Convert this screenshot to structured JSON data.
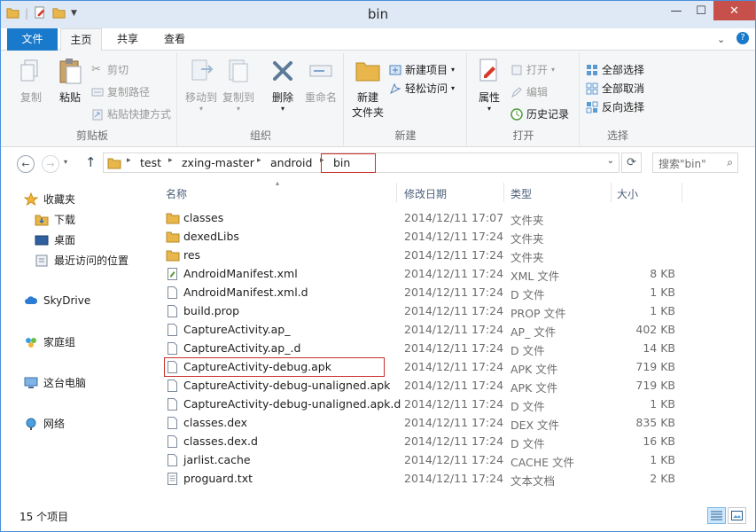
{
  "window": {
    "title": "bin"
  },
  "colors": {
    "accent": "#1979ca",
    "highlight": "#c9302c",
    "folder": "#e8b64a"
  },
  "tabs": [
    {
      "label": "文件"
    },
    {
      "label": "主页"
    },
    {
      "label": "共享"
    },
    {
      "label": "查看"
    }
  ],
  "ribbon": {
    "clipboard": {
      "label": "剪贴板",
      "copy": "复制",
      "paste": "粘贴",
      "cut": "剪切",
      "copy_path": "复制路径",
      "paste_shortcut": "粘贴快捷方式"
    },
    "organize": {
      "label": "组织",
      "move_to": "移动到",
      "copy_to": "复制到",
      "delete": "删除",
      "rename": "重命名"
    },
    "new": {
      "label": "新建",
      "new_folder_l1": "新建",
      "new_folder_l2": "文件夹",
      "new_item": "新建项目",
      "easy_access": "轻松访问"
    },
    "open": {
      "label": "打开",
      "properties": "属性",
      "open": "打开",
      "edit": "编辑",
      "history": "历史记录"
    },
    "select": {
      "label": "选择",
      "select_all": "全部选择",
      "select_none": "全部取消",
      "invert": "反向选择"
    }
  },
  "address": {
    "crumbs": [
      "test",
      "zxing-master",
      "android",
      "bin"
    ],
    "search_placeholder": "搜索\"bin\""
  },
  "nav": {
    "favorites": "收藏夹",
    "downloads": "下载",
    "desktop": "桌面",
    "recent": "最近访问的位置",
    "skydrive": "SkyDrive",
    "homegroup": "家庭组",
    "this_pc": "这台电脑",
    "network": "网络"
  },
  "columns": {
    "name": "名称",
    "date": "修改日期",
    "type": "类型",
    "size": "大小"
  },
  "files": [
    {
      "name": "classes",
      "date": "2014/12/11 17:07",
      "type": "文件夹",
      "size": "",
      "icon": "folder-icon"
    },
    {
      "name": "dexedLibs",
      "date": "2014/12/11 17:24",
      "type": "文件夹",
      "size": "",
      "icon": "folder-icon"
    },
    {
      "name": "res",
      "date": "2014/12/11 17:24",
      "type": "文件夹",
      "size": "",
      "icon": "folder-icon"
    },
    {
      "name": "AndroidManifest.xml",
      "date": "2014/12/11 17:24",
      "type": "XML 文件",
      "size": "8 KB",
      "icon": "xml-file-icon"
    },
    {
      "name": "AndroidManifest.xml.d",
      "date": "2014/12/11 17:24",
      "type": "D 文件",
      "size": "1 KB",
      "icon": "file-icon"
    },
    {
      "name": "build.prop",
      "date": "2014/12/11 17:24",
      "type": "PROP 文件",
      "size": "1 KB",
      "icon": "file-icon"
    },
    {
      "name": "CaptureActivity.ap_",
      "date": "2014/12/11 17:24",
      "type": "AP_ 文件",
      "size": "402 KB",
      "icon": "file-icon"
    },
    {
      "name": "CaptureActivity.ap_.d",
      "date": "2014/12/11 17:24",
      "type": "D 文件",
      "size": "14 KB",
      "icon": "file-icon"
    },
    {
      "name": "CaptureActivity-debug.apk",
      "date": "2014/12/11 17:24",
      "type": "APK 文件",
      "size": "719 KB",
      "icon": "file-icon"
    },
    {
      "name": "CaptureActivity-debug-unaligned.apk",
      "date": "2014/12/11 17:24",
      "type": "APK 文件",
      "size": "719 KB",
      "icon": "file-icon"
    },
    {
      "name": "CaptureActivity-debug-unaligned.apk.d",
      "date": "2014/12/11 17:24",
      "type": "D 文件",
      "size": "1 KB",
      "icon": "file-icon"
    },
    {
      "name": "classes.dex",
      "date": "2014/12/11 17:24",
      "type": "DEX 文件",
      "size": "835 KB",
      "icon": "file-icon"
    },
    {
      "name": "classes.dex.d",
      "date": "2014/12/11 17:24",
      "type": "D 文件",
      "size": "16 KB",
      "icon": "file-icon"
    },
    {
      "name": "jarlist.cache",
      "date": "2014/12/11 17:24",
      "type": "CACHE 文件",
      "size": "1 KB",
      "icon": "file-icon"
    },
    {
      "name": "proguard.txt",
      "date": "2014/12/11 17:24",
      "type": "文本文档",
      "size": "2 KB",
      "icon": "text-file-icon"
    }
  ],
  "status": {
    "item_count": "15 个项目"
  }
}
